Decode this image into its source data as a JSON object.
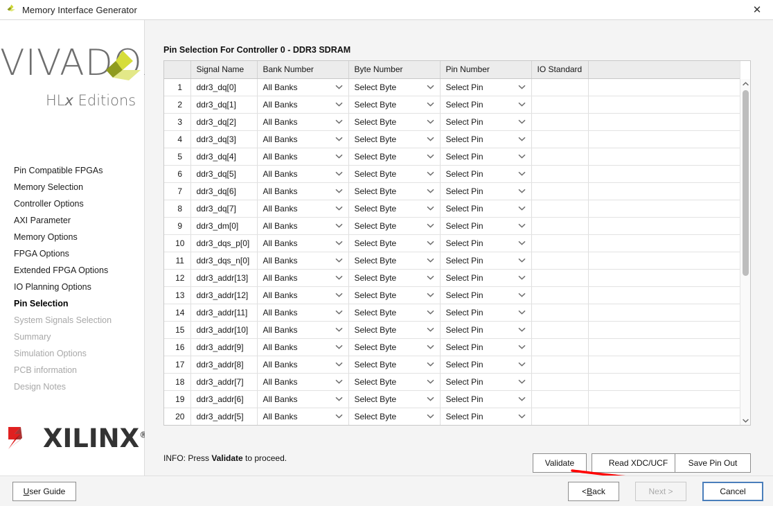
{
  "window": {
    "title": "Memory Interface Generator",
    "icon": "vivado-pinwheel-icon",
    "close_label": "✕"
  },
  "sidebar": {
    "logo": {
      "wordmark": "VIVADO",
      "dot": ".",
      "sub_prefix": "HL",
      "sub_italic": "x",
      "sub_suffix": " Editions",
      "mark_colors": [
        "#d6dd3a",
        "#cdd633",
        "#8f9b1e",
        "#e3e888"
      ]
    },
    "items": [
      {
        "label": "Pin Compatible FPGAs",
        "state": "normal"
      },
      {
        "label": "Memory Selection",
        "state": "normal"
      },
      {
        "label": "Controller Options",
        "state": "normal"
      },
      {
        "label": "AXI Parameter",
        "state": "normal"
      },
      {
        "label": "Memory Options",
        "state": "normal"
      },
      {
        "label": "FPGA Options",
        "state": "normal"
      },
      {
        "label": "Extended FPGA Options",
        "state": "normal"
      },
      {
        "label": "IO Planning Options",
        "state": "normal"
      },
      {
        "label": "Pin Selection",
        "state": "active"
      },
      {
        "label": "System Signals Selection",
        "state": "disabled"
      },
      {
        "label": "Summary",
        "state": "disabled"
      },
      {
        "label": "Simulation Options",
        "state": "disabled"
      },
      {
        "label": "PCB information",
        "state": "disabled"
      },
      {
        "label": "Design Notes",
        "state": "disabled"
      }
    ],
    "vendor_logo": {
      "word": "XILINX",
      "registered": "®",
      "mark_colors": [
        "#e02020",
        "#9b1010"
      ]
    }
  },
  "main": {
    "panel_title": "Pin Selection For Controller 0 - DDR3 SDRAM",
    "table": {
      "columns": [
        "",
        "Signal Name",
        "Bank Number",
        "Byte Number",
        "Pin Number",
        "IO Standard",
        ""
      ],
      "rows": [
        {
          "idx": "1",
          "signal": "ddr3_dq[0]",
          "bank": "All Banks",
          "byte": "Select Byte",
          "pin": "Select Pin",
          "io": ""
        },
        {
          "idx": "2",
          "signal": "ddr3_dq[1]",
          "bank": "All Banks",
          "byte": "Select Byte",
          "pin": "Select Pin",
          "io": ""
        },
        {
          "idx": "3",
          "signal": "ddr3_dq[2]",
          "bank": "All Banks",
          "byte": "Select Byte",
          "pin": "Select Pin",
          "io": ""
        },
        {
          "idx": "4",
          "signal": "ddr3_dq[3]",
          "bank": "All Banks",
          "byte": "Select Byte",
          "pin": "Select Pin",
          "io": ""
        },
        {
          "idx": "5",
          "signal": "ddr3_dq[4]",
          "bank": "All Banks",
          "byte": "Select Byte",
          "pin": "Select Pin",
          "io": ""
        },
        {
          "idx": "6",
          "signal": "ddr3_dq[5]",
          "bank": "All Banks",
          "byte": "Select Byte",
          "pin": "Select Pin",
          "io": ""
        },
        {
          "idx": "7",
          "signal": "ddr3_dq[6]",
          "bank": "All Banks",
          "byte": "Select Byte",
          "pin": "Select Pin",
          "io": ""
        },
        {
          "idx": "8",
          "signal": "ddr3_dq[7]",
          "bank": "All Banks",
          "byte": "Select Byte",
          "pin": "Select Pin",
          "io": ""
        },
        {
          "idx": "9",
          "signal": "ddr3_dm[0]",
          "bank": "All Banks",
          "byte": "Select Byte",
          "pin": "Select Pin",
          "io": ""
        },
        {
          "idx": "10",
          "signal": "ddr3_dqs_p[0]",
          "bank": "All Banks",
          "byte": "Select Byte",
          "pin": "Select Pin",
          "io": ""
        },
        {
          "idx": "11",
          "signal": "ddr3_dqs_n[0]",
          "bank": "All Banks",
          "byte": "Select Byte",
          "pin": "Select Pin",
          "io": ""
        },
        {
          "idx": "12",
          "signal": "ddr3_addr[13]",
          "bank": "All Banks",
          "byte": "Select Byte",
          "pin": "Select Pin",
          "io": ""
        },
        {
          "idx": "13",
          "signal": "ddr3_addr[12]",
          "bank": "All Banks",
          "byte": "Select Byte",
          "pin": "Select Pin",
          "io": ""
        },
        {
          "idx": "14",
          "signal": "ddr3_addr[11]",
          "bank": "All Banks",
          "byte": "Select Byte",
          "pin": "Select Pin",
          "io": ""
        },
        {
          "idx": "15",
          "signal": "ddr3_addr[10]",
          "bank": "All Banks",
          "byte": "Select Byte",
          "pin": "Select Pin",
          "io": ""
        },
        {
          "idx": "16",
          "signal": "ddr3_addr[9]",
          "bank": "All Banks",
          "byte": "Select Byte",
          "pin": "Select Pin",
          "io": ""
        },
        {
          "idx": "17",
          "signal": "ddr3_addr[8]",
          "bank": "All Banks",
          "byte": "Select Byte",
          "pin": "Select Pin",
          "io": ""
        },
        {
          "idx": "18",
          "signal": "ddr3_addr[7]",
          "bank": "All Banks",
          "byte": "Select Byte",
          "pin": "Select Pin",
          "io": ""
        },
        {
          "idx": "19",
          "signal": "ddr3_addr[6]",
          "bank": "All Banks",
          "byte": "Select Byte",
          "pin": "Select Pin",
          "io": ""
        },
        {
          "idx": "20",
          "signal": "ddr3_addr[5]",
          "bank": "All Banks",
          "byte": "Select Byte",
          "pin": "Select Pin",
          "io": ""
        }
      ]
    },
    "scrollbar": {
      "up": "▲",
      "down": "▼",
      "position_percent": 4
    },
    "info": {
      "prefix": "INFO: Press ",
      "bold": "Validate",
      "suffix": " to proceed."
    },
    "actions": {
      "validate": "Validate",
      "read_xdc_ucf": "Read XDC/UCF",
      "save_pin_out": "Save Pin Out"
    },
    "annotation": {
      "color": "#ff0000",
      "target": "read_xdc_ucf"
    }
  },
  "footer": {
    "user_guide": {
      "mnemonic": "U",
      "rest": "ser Guide"
    },
    "back": {
      "prefix": "< ",
      "mnemonic": "B",
      "rest": "ack"
    },
    "next": "Next >",
    "cancel": "Cancel",
    "accent": "#4a7ebb"
  }
}
